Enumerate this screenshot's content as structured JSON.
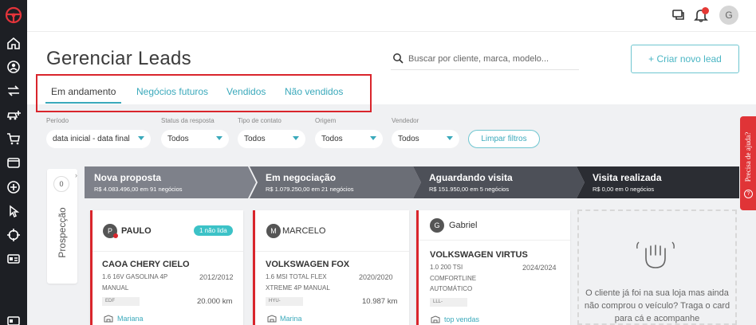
{
  "header": {
    "title": "Gerenciar Leads",
    "search_placeholder": "Buscar por cliente, marca, modelo...",
    "create_button": "+ Criar novo lead"
  },
  "topbar": {
    "avatar_initial": "G"
  },
  "tabs": [
    {
      "label": "Em andamento",
      "active": true
    },
    {
      "label": "Negócios futuros",
      "active": false
    },
    {
      "label": "Vendidos",
      "active": false
    },
    {
      "label": "Não vendidos",
      "active": false
    }
  ],
  "filters": [
    {
      "label": "Período",
      "value": "data inicial - data final"
    },
    {
      "label": "Status da resposta",
      "value": "Todos"
    },
    {
      "label": "Tipo de contato",
      "value": "Todos"
    },
    {
      "label": "Origem",
      "value": "Todos"
    },
    {
      "label": "Vendedor",
      "value": "Todos"
    }
  ],
  "clear_filters": "Limpar filtros",
  "prospeccao": {
    "label": "Prospecção",
    "count": "0"
  },
  "stages": [
    {
      "title": "Nova proposta",
      "summary": "R$ 4.083.496,00 em 91 negócios"
    },
    {
      "title": "Em negociação",
      "summary": "R$ 1.079.250,00 em 21 negócios"
    },
    {
      "title": "Aguardando visita",
      "summary": "R$ 151.950,00 em 5 negócios"
    },
    {
      "title": "Visita realizada",
      "summary": "R$ 0,00 em 0 negócios"
    }
  ],
  "cards": [
    {
      "initial": "P",
      "name": "PAULO",
      "badge": "1 não lida",
      "model": "CAOA CHERY CIELO",
      "spec_1": "1.6 16V GASOLINA 4P",
      "spec_2": "MANUAL",
      "year": "2012/2012",
      "plate": "EDF",
      "km": "20.000 km",
      "seller": "Mariana"
    },
    {
      "initial": "M",
      "name": "MARCELO",
      "model": "VOLKSWAGEN FOX",
      "spec_1": "1.6 MSI TOTAL FLEX",
      "spec_2": "XTREME 4P MANUAL",
      "year": "2020/2020",
      "plate": "HYU-",
      "km": "10.987 km",
      "seller": "Marina"
    },
    {
      "initial": "G",
      "name": "Gabriel",
      "model": "VOLKSWAGEN VIRTUS",
      "spec_1": "1.0 200 TSI",
      "spec_2": "COMFORTLINE",
      "spec_3": "AUTOMÁTICO",
      "year": "2024/2024",
      "plate": "LLL-",
      "seller": "top vendas"
    }
  ],
  "empty_stage_text": "O cliente já foi na sua loja mas ainda não comprou o veículo? Traga o card para cá e acompanhe",
  "help_tab": "Precisa de ajuda?",
  "colors": {
    "accent": "#3aa9bb",
    "sidebar": "#1d1f24",
    "highlight_red": "#d9252c",
    "stage_dark": "#2b2d33",
    "stage_mid": "#4d5058",
    "stage_light": "#7e818a"
  }
}
